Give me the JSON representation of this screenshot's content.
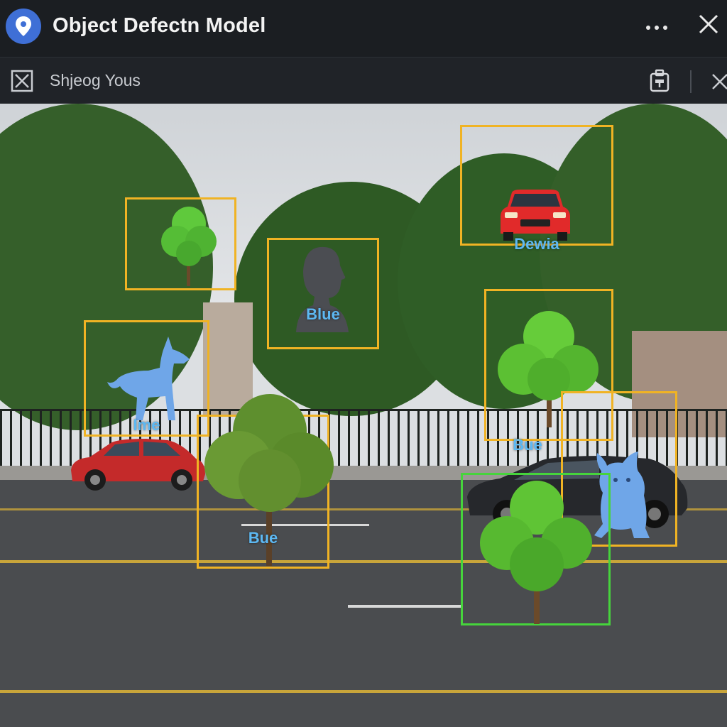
{
  "titlebar": {
    "app_icon": "location-pin-icon",
    "title": "Object Defectn Model",
    "more_icon": "more-horizontal-icon",
    "close_icon": "close-icon"
  },
  "toolbar": {
    "left_icon": "image-close-icon",
    "label": "Shjeog Yous",
    "share_icon": "share-icon",
    "close_icon": "close-icon"
  },
  "detections": [
    {
      "id": "tree-1",
      "object": "tree",
      "label": "",
      "color": "#f0b324"
    },
    {
      "id": "bust",
      "object": "bust",
      "label": "Blue",
      "color": "#f0b324"
    },
    {
      "id": "car-top",
      "object": "car",
      "label": "Dewia",
      "color": "#f0b324"
    },
    {
      "id": "dog",
      "object": "dog",
      "label": "Ime",
      "color": "#f0b324"
    },
    {
      "id": "tree-2",
      "object": "tree",
      "label": "Bue",
      "color": "#f0b324"
    },
    {
      "id": "tree-3",
      "object": "tree",
      "label": "Bue",
      "color": "#f0b324"
    },
    {
      "id": "creature",
      "object": "creature",
      "label": "",
      "color": "#f0b324"
    },
    {
      "id": "tree-4",
      "object": "tree",
      "label": "",
      "color": "#46d43c"
    }
  ],
  "colors": {
    "box_yellow": "#f0b324",
    "box_green": "#46d43c",
    "label_blue": "#5db8f2",
    "accent_blue": "#3f6fd6"
  }
}
